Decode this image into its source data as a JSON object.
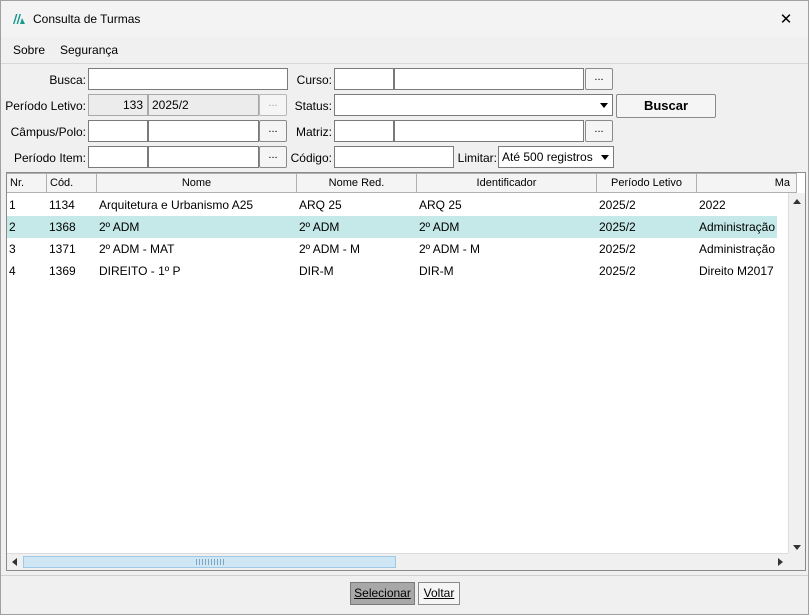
{
  "window": {
    "title": "Consulta de Turmas",
    "close_glyph": "✕"
  },
  "menu": [
    {
      "label": "Sobre"
    },
    {
      "label": "Segurança"
    }
  ],
  "filters": {
    "busca_label": "Busca:",
    "busca_value": "",
    "periodo_label": "Período Letivo:",
    "periodo_code": "133",
    "periodo_name": "2025/2",
    "campus_label": "Câmpus/Polo:",
    "campus_code": "",
    "campus_name": "",
    "periodo_item_label": "Período Item:",
    "periodo_item_code": "",
    "periodo_item_name": "",
    "curso_label": "Curso:",
    "curso_code": "",
    "curso_name": "",
    "status_label": "Status:",
    "status_value": "",
    "matriz_label": "Matriz:",
    "matriz_code": "",
    "matriz_name": "",
    "codigo_label": "Código:",
    "codigo_value": "",
    "limitar_label": "Limitar:",
    "limitar_value": "Até 500 registros",
    "lookup_glyph": "...",
    "buscar_label": "Buscar"
  },
  "grid": {
    "columns": [
      "Nr.",
      "Cód.",
      "Nome",
      "Nome Red.",
      "Identificador",
      "Período Letivo",
      "Ma"
    ],
    "rows": [
      [
        "1",
        "1134",
        "Arquitetura e Urbanismo A25",
        "ARQ 25",
        "ARQ 25",
        "2025/2",
        "2022"
      ],
      [
        "2",
        "1368",
        "2º ADM",
        "2º ADM",
        "2º ADM",
        "2025/2",
        "Administração"
      ],
      [
        "3",
        "1371",
        "2º ADM - MAT",
        "2º ADM - M",
        "2º ADM - M",
        "2025/2",
        "Administração"
      ],
      [
        "4",
        "1369",
        "DIREITO - 1º P",
        "DIR-M",
        "DIR-M",
        "2025/2",
        "Direito M2017"
      ]
    ],
    "selected_row": 2
  },
  "footer": {
    "selecionar_label": "Selecionar",
    "voltar_label": "Voltar"
  },
  "colors": {
    "selected_row": "#c5e8e8",
    "accent": "#1a9a8f"
  }
}
